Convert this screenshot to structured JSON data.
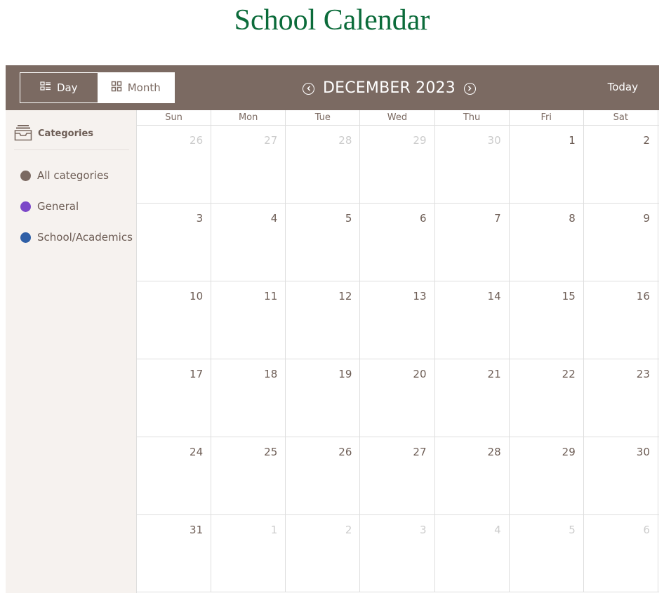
{
  "page": {
    "title": "School Calendar"
  },
  "header": {
    "views": {
      "day": "Day",
      "month": "Month",
      "active": "Month"
    },
    "period_title": "DECEMBER 2023",
    "today_label": "Today"
  },
  "sidebar": {
    "title": "Categories",
    "categories": [
      {
        "label": "All categories",
        "color": "#7b6a62"
      },
      {
        "label": "General",
        "color": "#7c48c8"
      },
      {
        "label": "School/Academics",
        "color": "#2f5fa6"
      }
    ]
  },
  "grid": {
    "weekdays": [
      "Sun",
      "Mon",
      "Tue",
      "Wed",
      "Thu",
      "Fri",
      "Sat"
    ],
    "weeks": [
      [
        {
          "d": "26",
          "other": true
        },
        {
          "d": "27",
          "other": true
        },
        {
          "d": "28",
          "other": true
        },
        {
          "d": "29",
          "other": true
        },
        {
          "d": "30",
          "other": true
        },
        {
          "d": "1",
          "other": false
        },
        {
          "d": "2",
          "other": false
        }
      ],
      [
        {
          "d": "3",
          "other": false
        },
        {
          "d": "4",
          "other": false
        },
        {
          "d": "5",
          "other": false
        },
        {
          "d": "6",
          "other": false
        },
        {
          "d": "7",
          "other": false
        },
        {
          "d": "8",
          "other": false
        },
        {
          "d": "9",
          "other": false
        }
      ],
      [
        {
          "d": "10",
          "other": false
        },
        {
          "d": "11",
          "other": false
        },
        {
          "d": "12",
          "other": false
        },
        {
          "d": "13",
          "other": false
        },
        {
          "d": "14",
          "other": false
        },
        {
          "d": "15",
          "other": false
        },
        {
          "d": "16",
          "other": false
        }
      ],
      [
        {
          "d": "17",
          "other": false
        },
        {
          "d": "18",
          "other": false
        },
        {
          "d": "19",
          "other": false
        },
        {
          "d": "20",
          "other": false
        },
        {
          "d": "21",
          "other": false
        },
        {
          "d": "22",
          "other": false
        },
        {
          "d": "23",
          "other": false
        }
      ],
      [
        {
          "d": "24",
          "other": false
        },
        {
          "d": "25",
          "other": false
        },
        {
          "d": "26",
          "other": false
        },
        {
          "d": "27",
          "other": false
        },
        {
          "d": "28",
          "other": false
        },
        {
          "d": "29",
          "other": false
        },
        {
          "d": "30",
          "other": false
        }
      ],
      [
        {
          "d": "31",
          "other": false
        },
        {
          "d": "1",
          "other": true
        },
        {
          "d": "2",
          "other": true
        },
        {
          "d": "3",
          "other": true
        },
        {
          "d": "4",
          "other": true
        },
        {
          "d": "5",
          "other": true
        },
        {
          "d": "6",
          "other": true
        }
      ]
    ]
  },
  "colors": {
    "header_bg": "#7b6a62",
    "title_green": "#0b6b3a",
    "sidebar_bg": "#f6f2ef"
  },
  "icons": {
    "day_view": "list-view-icon",
    "month_view": "grid-view-icon",
    "prev": "chevron-left-circle-icon",
    "next": "chevron-right-circle-icon",
    "categories": "inbox-tray-icon"
  }
}
